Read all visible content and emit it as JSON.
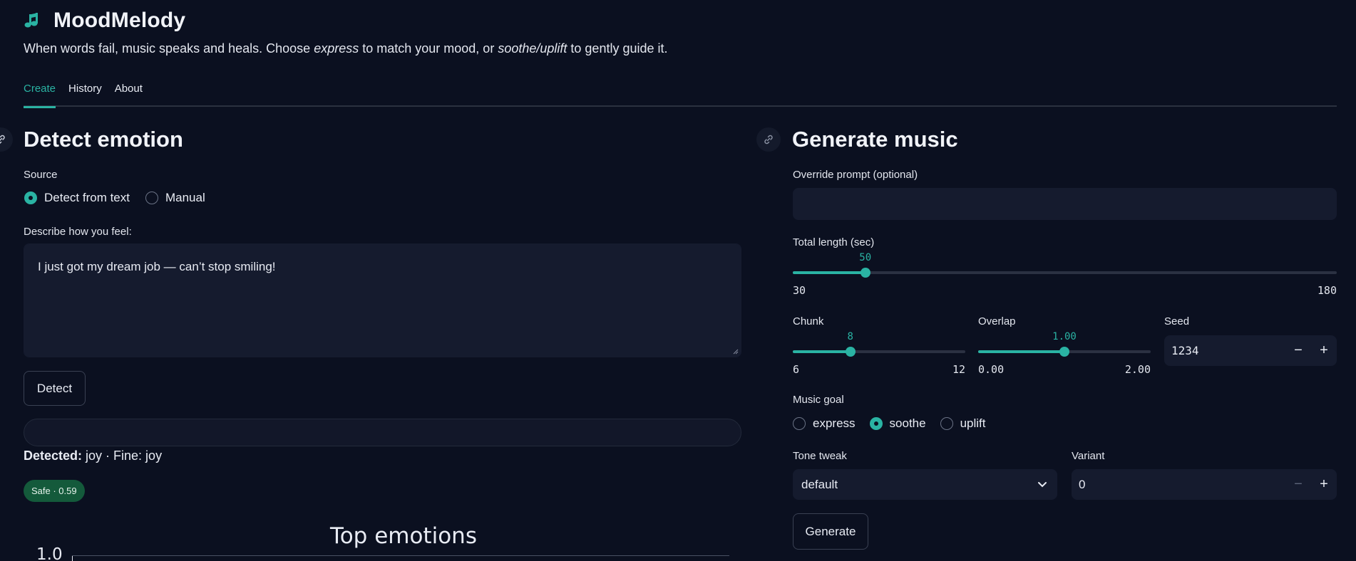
{
  "app": {
    "title": "MoodMelody",
    "subtitle_1": "When words fail, music speaks and heals. Choose ",
    "subtitle_em1": "express",
    "subtitle_2": " to match your mood, or ",
    "subtitle_em2": "soothe/uplift",
    "subtitle_3": " to gently guide it."
  },
  "tabs": [
    {
      "label": "Create",
      "active": true
    },
    {
      "label": "History",
      "active": false
    },
    {
      "label": "About",
      "active": false
    }
  ],
  "detect": {
    "heading": "Detect emotion",
    "source_label": "Source",
    "source_options": [
      {
        "label": "Detect from text",
        "selected": true
      },
      {
        "label": "Manual",
        "selected": false
      }
    ],
    "describe_label": "Describe how you feel:",
    "text_value": "I just got my dream job — can’t stop smiling!",
    "detect_button": "Detect",
    "detected_label": "Detected:",
    "detected_value": " joy · Fine: joy",
    "safety_badge": "Safe · 0.59",
    "chart_title": "Top emotions",
    "chart_ytick_top": "1.0"
  },
  "generate": {
    "heading": "Generate music",
    "override_label": "Override prompt (optional)",
    "override_value": "",
    "total_length": {
      "label": "Total length (sec)",
      "value": "50",
      "min": "30",
      "max": "180",
      "fraction": 0.1333
    },
    "chunk": {
      "label": "Chunk",
      "value": "8",
      "min": "6",
      "max": "12",
      "fraction": 0.3333
    },
    "overlap": {
      "label": "Overlap",
      "value": "1.00",
      "min": "0.00",
      "max": "2.00",
      "fraction": 0.5
    },
    "seed": {
      "label": "Seed",
      "value": "1234",
      "minus": "−",
      "plus": "+"
    },
    "goal_label": "Music goal",
    "goal_options": [
      {
        "label": "express",
        "selected": false
      },
      {
        "label": "soothe",
        "selected": true
      },
      {
        "label": "uplift",
        "selected": false
      }
    ],
    "tone_label": "Tone tweak",
    "tone_value": "default",
    "variant": {
      "label": "Variant",
      "value": "0",
      "minus": "−",
      "plus": "+"
    },
    "generate_button": "Generate"
  },
  "colors": {
    "accent": "#2ab3a3",
    "background": "#0b1020",
    "input_bg": "#151b2e",
    "badge_bg": "#145a3b"
  },
  "icons": [
    "music-note-icon",
    "link-icon",
    "chevron-down-icon"
  ]
}
